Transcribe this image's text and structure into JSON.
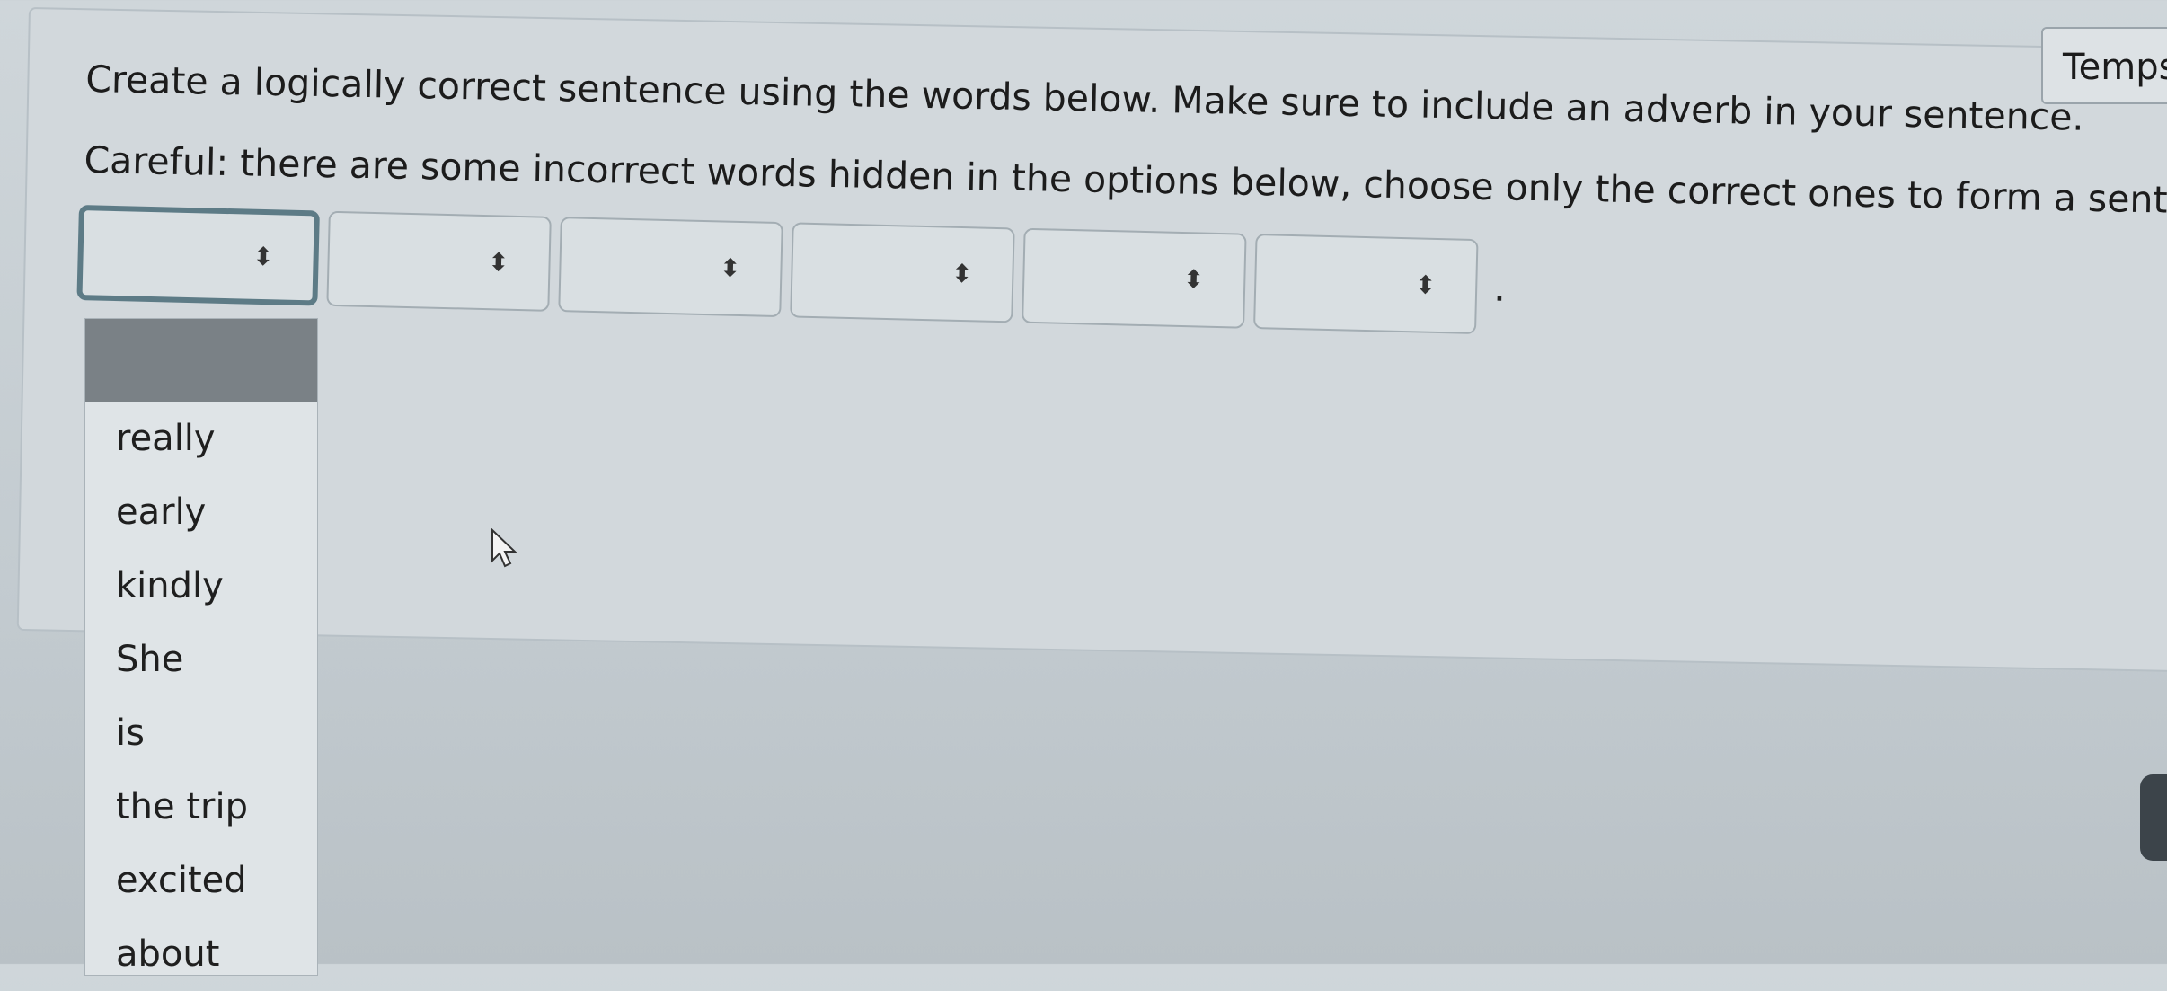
{
  "header": {
    "temps_label": "Temps"
  },
  "instructions": {
    "line1": "Create a logically correct sentence using the words below. Make sure to include an adverb in your sentence.",
    "line2": "Careful: there are some incorrect words hidden in the options below, choose only the correct ones to form a sentence."
  },
  "selects": [
    {
      "value": "",
      "arrow": "⬍"
    },
    {
      "value": "",
      "arrow": "⬍"
    },
    {
      "value": "",
      "arrow": "⬍"
    },
    {
      "value": "",
      "arrow": "⬍"
    },
    {
      "value": "",
      "arrow": "⬍"
    },
    {
      "value": "",
      "arrow": "⬍"
    }
  ],
  "sentence_end": ".",
  "dropdown": {
    "highlighted": "",
    "options": [
      "really",
      "early",
      "kindly",
      "She",
      "is",
      "the trip",
      "excited",
      "about"
    ]
  },
  "icons": {
    "cursor": "arrow-cursor-icon",
    "select_arrow": "sort-arrows-icon"
  }
}
